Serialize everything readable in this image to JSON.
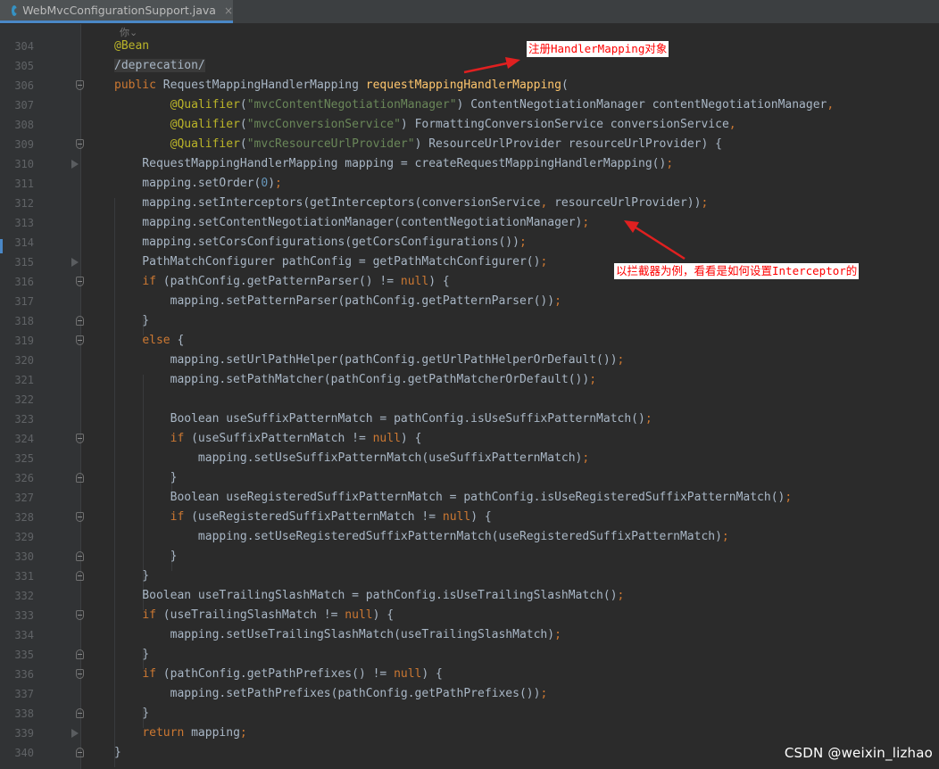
{
  "editor": {
    "tab": {
      "label": "WebMvcConfigurationSupport.java",
      "close": "×",
      "active": true
    },
    "inlay_hint": "你⌄",
    "lines": [
      {
        "n": "304",
        "code": [
          [
            "an",
            "@Bean"
          ]
        ]
      },
      {
        "n": "305",
        "code": [
          [
            "dep",
            "/deprecation/"
          ]
        ]
      },
      {
        "n": "306",
        "code": [
          [
            "kw",
            "public "
          ],
          [
            "",
            "RequestMappingHandlerMapping "
          ],
          [
            "fn",
            "requestMappingHandlerMapping"
          ],
          [
            "",
            "("
          ]
        ]
      },
      {
        "n": "307",
        "code": [
          [
            "",
            "        "
          ],
          [
            "an",
            "@Qualifier"
          ],
          [
            "",
            "("
          ],
          [
            "st",
            "\"mvcContentNegotiationManager\""
          ],
          [
            "",
            ") ContentNegotiationManager contentNegotiationManager"
          ],
          [
            "kw",
            ","
          ]
        ]
      },
      {
        "n": "308",
        "code": [
          [
            "",
            "        "
          ],
          [
            "an",
            "@Qualifier"
          ],
          [
            "",
            "("
          ],
          [
            "st",
            "\"mvcConversionService\""
          ],
          [
            "",
            ") FormattingConversionService conversionService"
          ],
          [
            "kw",
            ","
          ]
        ]
      },
      {
        "n": "309",
        "code": [
          [
            "",
            "        "
          ],
          [
            "an",
            "@Qualifier"
          ],
          [
            "",
            "("
          ],
          [
            "st",
            "\"mvcResourceUrlProvider\""
          ],
          [
            "",
            ") ResourceUrlProvider resourceUrlProvider) {"
          ]
        ]
      },
      {
        "n": "310",
        "code": [
          [
            "",
            "    RequestMappingHandlerMapping mapping = createRequestMappingHandlerMapping()"
          ],
          [
            "kw",
            ";"
          ]
        ]
      },
      {
        "n": "311",
        "code": [
          [
            "",
            "    mapping.setOrder("
          ],
          [
            "nm",
            "0"
          ],
          [
            "",
            ")"
          ],
          [
            "kw",
            ";"
          ]
        ]
      },
      {
        "n": "312",
        "code": [
          [
            "",
            "    mapping.setInterceptors(getInterceptors(conversionService"
          ],
          [
            "kw",
            ", "
          ],
          [
            "",
            "resourceUrlProvider))"
          ],
          [
            "kw",
            ";"
          ]
        ]
      },
      {
        "n": "313",
        "code": [
          [
            "",
            "    mapping.setContentNegotiationManager(contentNegotiationManager)"
          ],
          [
            "kw",
            ";"
          ]
        ]
      },
      {
        "n": "314",
        "code": [
          [
            "",
            "    mapping.setCorsConfigurations(getCorsConfigurations())"
          ],
          [
            "kw",
            ";"
          ]
        ]
      },
      {
        "n": "315",
        "code": [
          [
            "",
            "    PathMatchConfigurer pathConfig = getPathMatchConfigurer()"
          ],
          [
            "kw",
            ";"
          ]
        ]
      },
      {
        "n": "316",
        "code": [
          [
            "",
            "    "
          ],
          [
            "kw",
            "if "
          ],
          [
            "",
            "(pathConfig.getPatternParser() != "
          ],
          [
            "kw",
            "null"
          ],
          [
            "",
            ") {"
          ]
        ]
      },
      {
        "n": "317",
        "code": [
          [
            "",
            "        mapping.setPatternParser(pathConfig.getPatternParser())"
          ],
          [
            "kw",
            ";"
          ]
        ]
      },
      {
        "n": "318",
        "code": [
          [
            "",
            "    }"
          ]
        ]
      },
      {
        "n": "319",
        "code": [
          [
            "",
            "    "
          ],
          [
            "kw",
            "else "
          ],
          [
            "",
            "{"
          ]
        ]
      },
      {
        "n": "320",
        "code": [
          [
            "",
            "        mapping.setUrlPathHelper(pathConfig.getUrlPathHelperOrDefault())"
          ],
          [
            "kw",
            ";"
          ]
        ]
      },
      {
        "n": "321",
        "code": [
          [
            "",
            "        mapping.setPathMatcher(pathConfig.getPathMatcherOrDefault())"
          ],
          [
            "kw",
            ";"
          ]
        ]
      },
      {
        "n": "322",
        "code": []
      },
      {
        "n": "323",
        "code": [
          [
            "",
            "        Boolean useSuffixPatternMatch = pathConfig.isUseSuffixPatternMatch()"
          ],
          [
            "kw",
            ";"
          ]
        ]
      },
      {
        "n": "324",
        "code": [
          [
            "",
            "        "
          ],
          [
            "kw",
            "if "
          ],
          [
            "",
            "(useSuffixPatternMatch != "
          ],
          [
            "kw",
            "null"
          ],
          [
            "",
            ") {"
          ]
        ]
      },
      {
        "n": "325",
        "code": [
          [
            "",
            "            mapping.setUseSuffixPatternMatch(useSuffixPatternMatch)"
          ],
          [
            "kw",
            ";"
          ]
        ]
      },
      {
        "n": "326",
        "code": [
          [
            "",
            "        }"
          ]
        ]
      },
      {
        "n": "327",
        "code": [
          [
            "",
            "        Boolean useRegisteredSuffixPatternMatch = pathConfig.isUseRegisteredSuffixPatternMatch()"
          ],
          [
            "kw",
            ";"
          ]
        ]
      },
      {
        "n": "328",
        "code": [
          [
            "",
            "        "
          ],
          [
            "kw",
            "if "
          ],
          [
            "",
            "(useRegisteredSuffixPatternMatch != "
          ],
          [
            "kw",
            "null"
          ],
          [
            "",
            ") {"
          ]
        ]
      },
      {
        "n": "329",
        "code": [
          [
            "",
            "            mapping.setUseRegisteredSuffixPatternMatch(useRegisteredSuffixPatternMatch)"
          ],
          [
            "kw",
            ";"
          ]
        ]
      },
      {
        "n": "330",
        "code": [
          [
            "",
            "        }"
          ]
        ]
      },
      {
        "n": "331",
        "code": [
          [
            "",
            "    }"
          ]
        ]
      },
      {
        "n": "332",
        "code": [
          [
            "",
            "    Boolean useTrailingSlashMatch = pathConfig.isUseTrailingSlashMatch()"
          ],
          [
            "kw",
            ";"
          ]
        ]
      },
      {
        "n": "333",
        "code": [
          [
            "",
            "    "
          ],
          [
            "kw",
            "if "
          ],
          [
            "",
            "(useTrailingSlashMatch != "
          ],
          [
            "kw",
            "null"
          ],
          [
            "",
            ") {"
          ]
        ]
      },
      {
        "n": "334",
        "code": [
          [
            "",
            "        mapping.setUseTrailingSlashMatch(useTrailingSlashMatch)"
          ],
          [
            "kw",
            ";"
          ]
        ]
      },
      {
        "n": "335",
        "code": [
          [
            "",
            "    }"
          ]
        ]
      },
      {
        "n": "336",
        "code": [
          [
            "",
            "    "
          ],
          [
            "kw",
            "if "
          ],
          [
            "",
            "(pathConfig.getPathPrefixes() != "
          ],
          [
            "kw",
            "null"
          ],
          [
            "",
            ") {"
          ]
        ]
      },
      {
        "n": "337",
        "code": [
          [
            "",
            "        mapping.setPathPrefixes(pathConfig.getPathPrefixes())"
          ],
          [
            "kw",
            ";"
          ]
        ]
      },
      {
        "n": "338",
        "code": [
          [
            "",
            "    }"
          ]
        ]
      },
      {
        "n": "339",
        "code": [
          [
            "",
            "    "
          ],
          [
            "kw",
            "return "
          ],
          [
            "",
            "mapping"
          ],
          [
            "kw",
            ";"
          ]
        ]
      },
      {
        "n": "340",
        "code": [
          [
            "",
            "}"
          ]
        ]
      }
    ]
  },
  "annotations": {
    "register": "注册HandlerMapping对象",
    "interceptor": "以拦截器为例，看看是如何设置Interceptor的"
  },
  "watermark": "CSDN @weixin_lizhao",
  "colors": {
    "background": "#2b2b2b",
    "keyword": "#cc7832",
    "annotation": "#bbb529",
    "string": "#6a8759",
    "number": "#6897bb",
    "method_decl": "#ffc66d",
    "callout_text": "#ff0000",
    "arrow": "#e02020"
  }
}
